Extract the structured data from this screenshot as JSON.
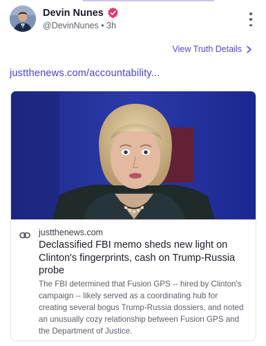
{
  "post": {
    "author_name": "Devin Nunes",
    "handle": "@DevinNunes",
    "separator": "•",
    "time_ago": "3h",
    "view_details_label": "View Truth Details",
    "link_text": "justthenews.com/accountability..."
  },
  "link_card": {
    "domain": "justthenews.com",
    "title": "Declassified FBI memo sheds new light on Clinton's fingerprints, cash on Trump-Russia probe",
    "description": "The FBI determined that Fusion GPS -- hired by Clinton's campaign -- likely served as a coordinating hub for creating several bogus Trump-Russia dossiers, and noted an unusually cozy relationship between Fusion GPS and the Department of Justice."
  },
  "colors": {
    "accent": "#5546d9",
    "verified_badge": "#e8336b",
    "text_primary": "#1b1b2b",
    "text_secondary": "#5b5e6b"
  },
  "icons": {
    "verified": "verified-badge-icon",
    "menu": "vertical-ellipsis-icon",
    "chevron": "chevron-right-icon",
    "link": "link-chain-icon"
  }
}
